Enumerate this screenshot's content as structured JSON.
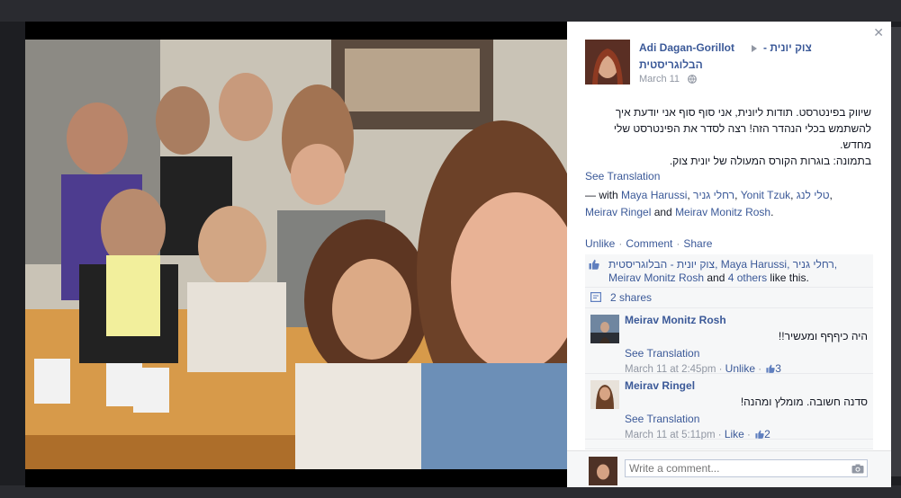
{
  "post": {
    "author": "Adi Dagan-Gorillot",
    "page_name_line1": "צוק יונית -",
    "page_name_line2": "הבלוגריסטית",
    "date": "March 11",
    "text_lines": [
      "שיווק בפינטרסט. תודות ליונית, אני סוף סוף אני יודעת איך",
      "להשתמש בכלי הנהדר הזה! רצה לסדר את הפינטרסט שלי",
      "מחדש.",
      "בתמונה: בוגרות הקורס המעולה של יונית צוק."
    ],
    "see_translation": "See Translation",
    "with_prefix": " — with ",
    "tagged": [
      "Maya Harussi",
      "רחלי גניר",
      "Yonit Tzuk",
      "טלי לנג",
      "Meirav Ringel",
      "Meirav Monitz Rosh"
    ],
    "tag_sep": ", ",
    "and_word": " and "
  },
  "actions": {
    "unlike": "Unlike",
    "comment": "Comment",
    "share": "Share",
    "separator": "·"
  },
  "likes": {
    "names": "צוק יונית - הבלוגריסטית, Maya Harussi, רחלי גניר, Meirav Monitz Rosh",
    "and_word": " and ",
    "others": "4 others",
    "suffix": " like this."
  },
  "shares": {
    "label": "2 shares"
  },
  "comments": [
    {
      "name": "Meirav Monitz Rosh",
      "text": "היה כיףףף ומעשיר!!",
      "see_translation": "See Translation",
      "time": "March 11 at 2:45pm",
      "action": "Unlike",
      "likes": "3"
    },
    {
      "name": "Meirav Ringel",
      "text": "סדנה חשובה. מומלץ ומהנה!",
      "see_translation": "See Translation",
      "time": "March 11 at 5:11pm",
      "action": "Like",
      "likes": "2"
    }
  ],
  "composer": {
    "placeholder": "Write a comment..."
  },
  "icons": {
    "close": "close-icon",
    "arrow": "right-arrow-icon",
    "globe": "globe-icon",
    "like": "thumbs-up-icon",
    "share": "share-icon",
    "camera": "camera-icon"
  },
  "colors": {
    "link": "#3b5998",
    "text": "#141823",
    "meta": "#9197a3",
    "ufi_bg": "#f6f7f8"
  }
}
